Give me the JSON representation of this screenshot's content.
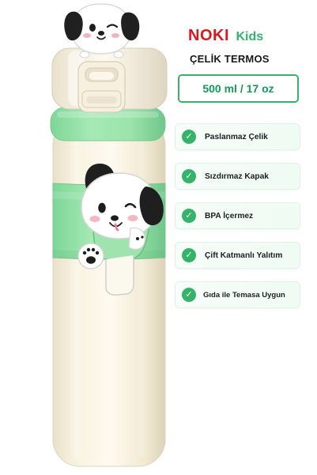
{
  "brand": {
    "name": "NOKI",
    "sub": "Kids"
  },
  "product": {
    "type": "ÇELİK TERMOS",
    "capacity": "500 ml / 17 oz"
  },
  "features": [
    {
      "label": "Paslanmaz Çelik",
      "icon": "check-icon"
    },
    {
      "label": "Sızdırmaz Kapak",
      "icon": "check-icon"
    },
    {
      "label": "BPA İçermez",
      "icon": "check-icon"
    },
    {
      "label": "Çift Katmanlı Yalıtım",
      "icon": "check-icon"
    },
    {
      "label": "Gıda ile Temasa Uygun",
      "icon": "check-icon"
    }
  ],
  "colors": {
    "brand_red": "#d71920",
    "accent_green": "#35b36a",
    "mint_green": "#9fe0ad",
    "cream": "#f4efdb"
  },
  "icons": {
    "check": "✓"
  }
}
